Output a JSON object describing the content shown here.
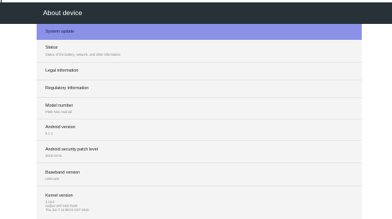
{
  "app_bar": {
    "title": "About device"
  },
  "items": [
    {
      "title": "System update"
    },
    {
      "title": "Status",
      "subtitle": "Status of the battery, network, and other information"
    },
    {
      "title": "Legal information"
    },
    {
      "title": "Regulatory information"
    },
    {
      "title": "Model number",
      "subtitle": "P500 Neo Android"
    },
    {
      "title": "Android version",
      "subtitle": "5.1.1"
    },
    {
      "title": "Android security patch level",
      "subtitle": "2016-04-01"
    },
    {
      "title": "Baseband version",
      "subtitle": "Unknown"
    },
    {
      "title": "Kernel version",
      "subtitle_lines": [
        "3.10.0",
        "cx@ce-297-H03 #189",
        "Thu Jun 7 11:08:04 CST 2018"
      ]
    }
  ],
  "colors": {
    "app_bar": "#263238",
    "highlight": "#8a91e6",
    "list_background": "#f4f4f4"
  }
}
